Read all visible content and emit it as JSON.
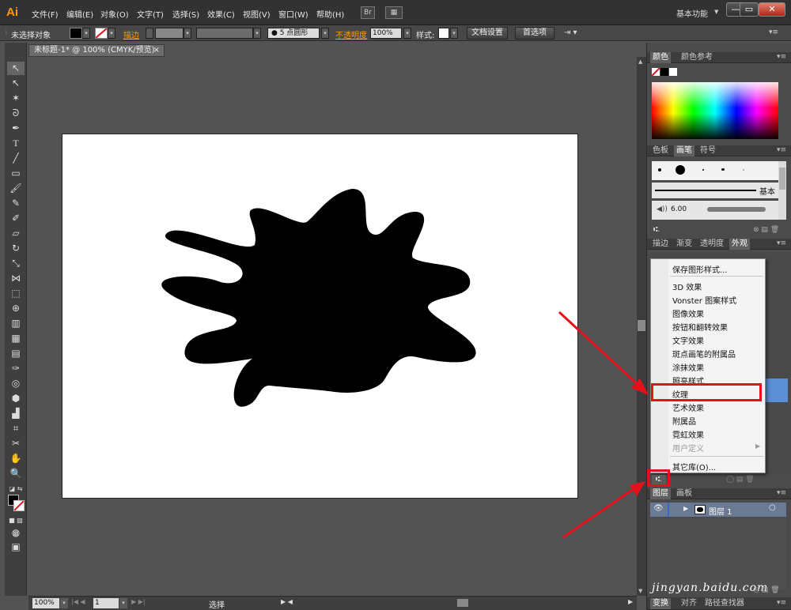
{
  "app": {
    "logo": "Ai"
  },
  "menubar": {
    "items": [
      "文件(F)",
      "编辑(E)",
      "对象(O)",
      "文字(T)",
      "选择(S)",
      "效果(C)",
      "视图(V)",
      "窗口(W)",
      "帮助(H)"
    ],
    "bridge_label": "Br",
    "workspace": "基本功能",
    "window_buttons": [
      "—",
      "▭",
      "✕"
    ]
  },
  "control_bar": {
    "selection_label": "未选择对象",
    "stroke_label": "描边",
    "brush_label": "● 5 点圆形",
    "opacity_label": "不透明度",
    "opacity_value": "100%",
    "style_label": "样式:",
    "doc_setup_button": "文档设置",
    "preferences_button": "首选项"
  },
  "document": {
    "tab_title": "未标题-1* @ 100% (CMYK/预览)",
    "tab_close": "×"
  },
  "status_bar": {
    "zoom": "100%",
    "page": "1",
    "tool_name": "选择"
  },
  "color_panel": {
    "tabs": [
      "颜色",
      "颜色参考"
    ]
  },
  "brush_panel": {
    "tabs": [
      "色板",
      "画笔",
      "符号"
    ],
    "stroke_name": "基本",
    "size_value": "6.00"
  },
  "appearance_panel": {
    "tabs": [
      "描边",
      "渐变",
      "透明度",
      "外观"
    ]
  },
  "context_menu": {
    "items": [
      {
        "label": "保存图形样式...",
        "disabled": false
      },
      {
        "label": "3D 效果",
        "disabled": false
      },
      {
        "label": "Vonster 图案样式",
        "disabled": false
      },
      {
        "label": "图像效果",
        "disabled": false
      },
      {
        "label": "按钮和翻转效果",
        "disabled": false
      },
      {
        "label": "文字效果",
        "disabled": false
      },
      {
        "label": "斑点画笔的附属品",
        "disabled": false
      },
      {
        "label": "涂抹效果",
        "disabled": false
      },
      {
        "label": "照亮样式",
        "disabled": false
      },
      {
        "label": "纹理",
        "disabled": false
      },
      {
        "label": "艺术效果",
        "disabled": false
      },
      {
        "label": "附属品",
        "disabled": false
      },
      {
        "label": "霓虹效果",
        "disabled": false
      },
      {
        "label": "用户定义",
        "disabled": true
      },
      {
        "label": "其它库(O)...",
        "disabled": false
      }
    ]
  },
  "layers_panel": {
    "tabs": [
      "图层",
      "画板"
    ],
    "layer_name": "图层 1"
  },
  "bottom_panel": {
    "tabs": [
      "变换",
      "对齐",
      "路径查找器"
    ]
  },
  "watermark": "jingyan.baidu.com",
  "colors": {
    "highlight_red": "#e4111b",
    "accent_orange": "#ff9a00",
    "artboard": "#ffffff",
    "shape": "#000000"
  }
}
